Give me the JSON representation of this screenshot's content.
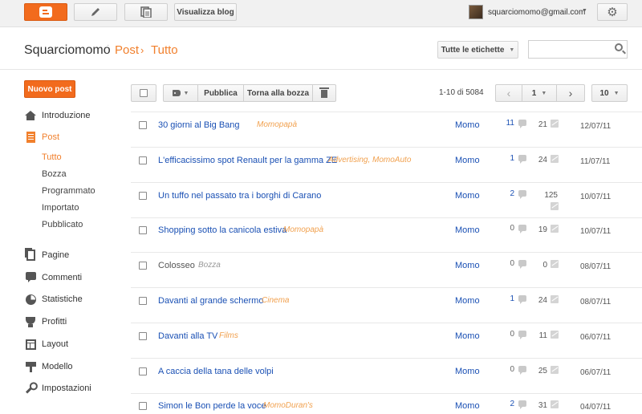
{
  "topbar": {
    "blogger_icon": "blogger-logo-icon",
    "pencil_icon": "pencil-icon",
    "pages_icon": "stacked-pages-icon",
    "view_blog_label": "Visualizza blog",
    "user_email": "squarciomomo@gmail.com",
    "gear_icon": "gear-icon",
    "accent_color": "#f26b1d"
  },
  "header": {
    "blog_name": "Squarciomomo",
    "breadcrumb_section": "Post",
    "breadcrumb_separator": "›",
    "breadcrumb_current": "Tutto",
    "labels_button": "Tutte le etichette",
    "search_placeholder": ""
  },
  "sidebar": {
    "new_post_label": "Nuovo post",
    "items": [
      {
        "label": "Introduzione",
        "icon": "home-icon"
      },
      {
        "label": "Post",
        "icon": "posts-icon",
        "active": true
      },
      {
        "label": "Pagine",
        "icon": "pages-icon"
      },
      {
        "label": "Commenti",
        "icon": "comments-icon"
      },
      {
        "label": "Statistiche",
        "icon": "stats-pie-icon"
      },
      {
        "label": "Profitti",
        "icon": "trophy-icon"
      },
      {
        "label": "Layout",
        "icon": "layout-icon"
      },
      {
        "label": "Modello",
        "icon": "paint-roller-icon"
      },
      {
        "label": "Impostazioni",
        "icon": "wrench-icon"
      }
    ],
    "post_subitems": [
      "Tutto",
      "Bozza",
      "Programmato",
      "Importato",
      "Pubblicato"
    ]
  },
  "toolbar": {
    "publish_label": "Pubblica",
    "revert_draft_label": "Torna alla bozza",
    "range_text": "1-10 di 5084",
    "prev_arrow": "‹",
    "next_arrow": "›",
    "current_page": "1",
    "per_page": "10"
  },
  "posts": [
    {
      "title": "30 giorni al Big Bang",
      "labels": "Momopapà",
      "author": "Momo",
      "comments": "11",
      "views": "21",
      "date": "12/07/11",
      "draft": false
    },
    {
      "title": "L'efficacissimo spot Renault per la gamma ZE",
      "labels": "Advertising, MomoAuto",
      "author": "Momo",
      "comments": "1",
      "views": "24",
      "date": "11/07/11",
      "draft": false
    },
    {
      "title": "Un tuffo nel passato tra i borghi di Carano",
      "labels": "",
      "author": "Momo",
      "comments": "2",
      "views": "125",
      "date": "10/07/11",
      "draft": false
    },
    {
      "title": "Shopping sotto la canicola estiva",
      "labels": "Momopapà",
      "author": "Momo",
      "comments": "0",
      "views": "19",
      "date": "10/07/11",
      "draft": false
    },
    {
      "title": "Colosseo",
      "labels": "Bozza",
      "author": "Momo",
      "comments": "0",
      "views": "0",
      "date": "08/07/11",
      "draft": true
    },
    {
      "title": "Davanti al grande schermo",
      "labels": "Cinema",
      "author": "Momo",
      "comments": "1",
      "views": "24",
      "date": "08/07/11",
      "draft": false
    },
    {
      "title": "Davanti alla TV",
      "labels": "Films",
      "author": "Momo",
      "comments": "0",
      "views": "11",
      "date": "06/07/11",
      "draft": false
    },
    {
      "title": "A caccia della tana delle volpi",
      "labels": "",
      "author": "Momo",
      "comments": "0",
      "views": "25",
      "date": "06/07/11",
      "draft": false
    },
    {
      "title": "Simon le Bon perde la voce",
      "labels": "MomoDuran's",
      "author": "Momo",
      "comments": "2",
      "views": "31",
      "date": "04/07/11",
      "draft": false
    }
  ]
}
